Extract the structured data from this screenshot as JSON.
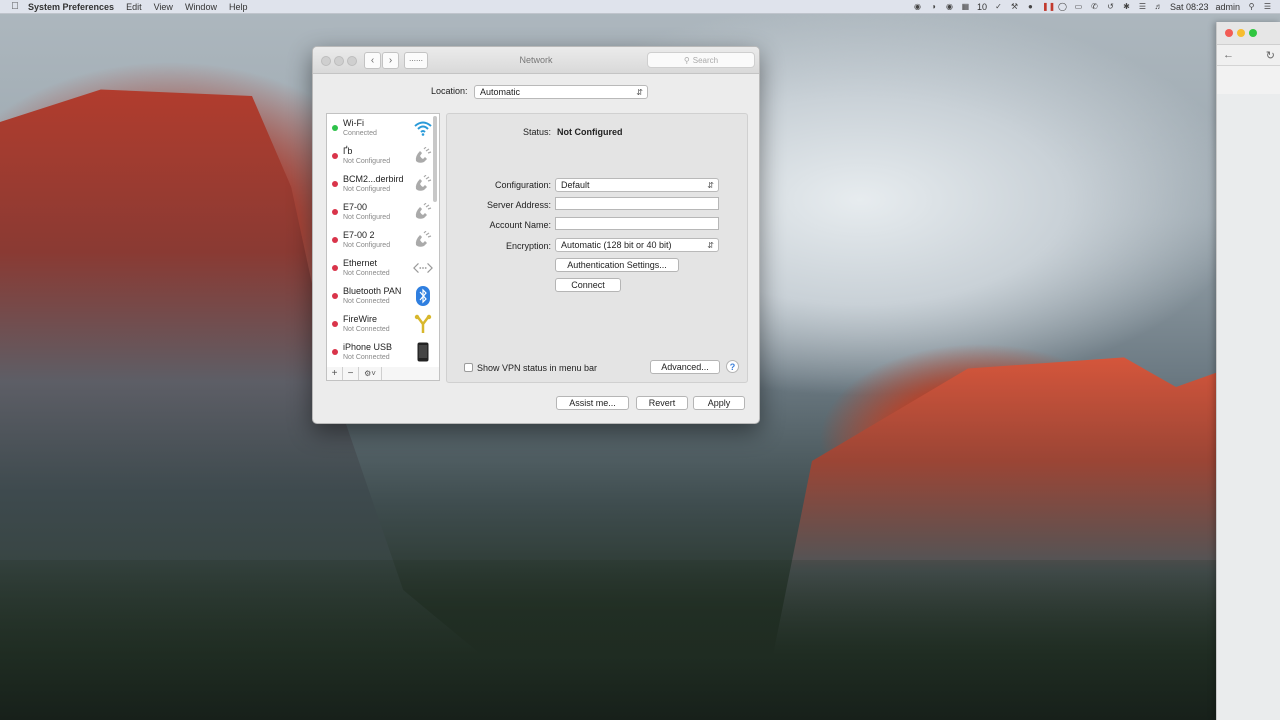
{
  "menubar": {
    "app": "System Preferences",
    "menus": [
      "Edit",
      "View",
      "Window",
      "Help"
    ],
    "battery_level": "10",
    "clock": "Sat 08:23",
    "user": "admin"
  },
  "window": {
    "title": "Network",
    "search_placeholder": "Search",
    "location_label": "Location:",
    "location_value": "Automatic"
  },
  "services": [
    {
      "name": "Wi-Fi",
      "status": "Connected",
      "led": "#2ec24a",
      "icon": "wifi-icon"
    },
    {
      "name": "Ґb",
      "status": "Not Configured",
      "led": "#d9344a",
      "icon": "phone-icon"
    },
    {
      "name": "BCM2...derbird",
      "status": "Not Configured",
      "led": "#d9344a",
      "icon": "phone-icon"
    },
    {
      "name": "E7-00",
      "status": "Not Configured",
      "led": "#d9344a",
      "icon": "phone-icon"
    },
    {
      "name": "E7-00 2",
      "status": "Not Configured",
      "led": "#d9344a",
      "icon": "phone-icon"
    },
    {
      "name": "Ethernet",
      "status": "Not Connected",
      "led": "#d9344a",
      "icon": "ethernet-icon"
    },
    {
      "name": "Bluetooth PAN",
      "status": "Not Connected",
      "led": "#d9344a",
      "icon": "bluetooth-icon"
    },
    {
      "name": "FireWire",
      "status": "Not Connected",
      "led": "#d9344a",
      "icon": "firewire-icon"
    },
    {
      "name": "iPhone USB",
      "status": "Not Connected",
      "led": "#d9344a",
      "icon": "iphone-icon"
    }
  ],
  "sidebar_footer": {
    "add": "+",
    "remove": "−",
    "gear": "⚙˅"
  },
  "detail": {
    "status_label": "Status:",
    "status_value": "Not Configured",
    "configuration_label": "Configuration:",
    "configuration_value": "Default",
    "server_label": "Server Address:",
    "server_value": "",
    "account_label": "Account Name:",
    "account_value": "",
    "encryption_label": "Encryption:",
    "encryption_value": "Automatic (128 bit or 40 bit)",
    "auth_button": "Authentication Settings...",
    "connect_button": "Connect",
    "show_vpn_label": "Show VPN status in menu bar",
    "advanced_button": "Advanced...",
    "help": "?"
  },
  "footer": {
    "assist": "Assist me...",
    "revert": "Revert",
    "apply": "Apply"
  },
  "colors": {
    "wifi": "#2a9ad8",
    "bluetooth": "#2f7fe0",
    "firewire": "#d8b72c"
  }
}
